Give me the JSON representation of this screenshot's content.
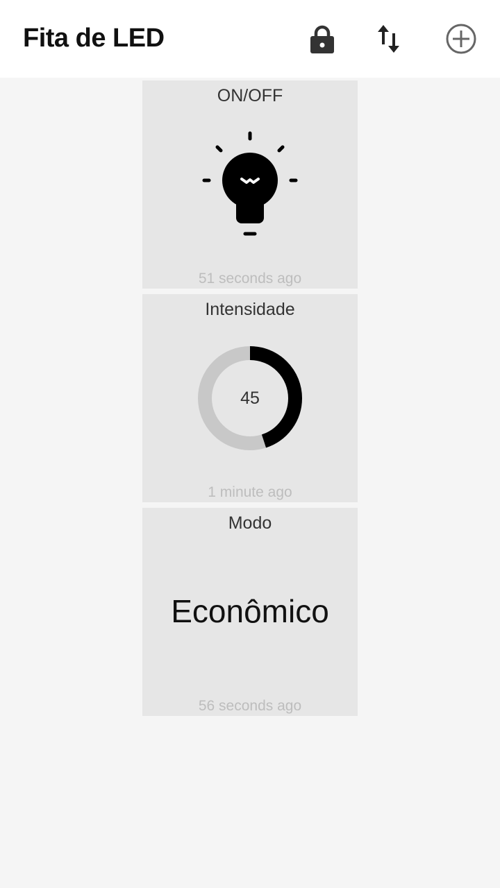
{
  "header": {
    "title": "Fita de LED",
    "actions": [
      {
        "icon": "lock-icon"
      },
      {
        "icon": "sort-arrows-icon"
      },
      {
        "icon": "add-circle-icon"
      }
    ]
  },
  "tiles": [
    {
      "title": "ON/OFF",
      "icon": "lightbulb-icon",
      "state": "on",
      "timestamp": "51 seconds ago"
    },
    {
      "title": "Intensidade",
      "value": "45",
      "level_fraction": 0.45,
      "timestamp": "1 minute ago"
    },
    {
      "title": "Modo",
      "value": "Econômico",
      "timestamp": "56 seconds ago"
    }
  ],
  "colors": {
    "background": "#f5f5f5",
    "app_bar": "#ffffff",
    "tile_background": "#e6e6e6",
    "gauge_fill": "#000000",
    "gauge_track": "#c8c8c8",
    "timestamp_text": "#bdbdbd"
  }
}
